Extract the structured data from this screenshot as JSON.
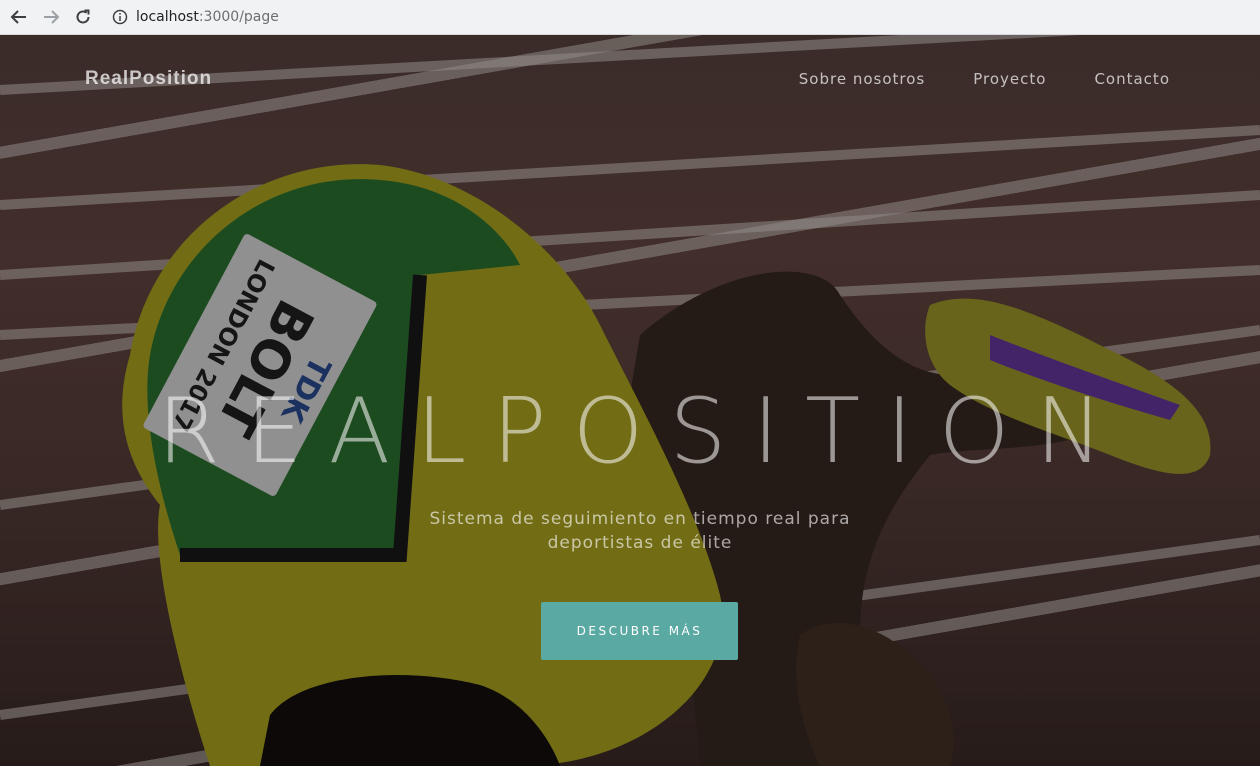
{
  "browser": {
    "url_host": "localhost",
    "url_path": ":3000/page"
  },
  "navbar": {
    "brand": "RealPosition",
    "links": [
      "Sobre nosotros",
      "Proyecto",
      "Contacto"
    ]
  },
  "hero": {
    "title": "REALPOSITION",
    "subtitle": "Sistema de seguimiento en tiempo real para deportistas de élite",
    "cta_label": "DESCUBRE MÁS",
    "bib_text": [
      "LONDON 2017",
      "BOLT",
      "TDK"
    ]
  },
  "colors": {
    "accent": "#5aa9a3",
    "track": "#6b4b45",
    "jersey": "#c8b81f"
  },
  "icons": [
    "back-arrow-icon",
    "forward-arrow-icon",
    "reload-icon",
    "info-icon"
  ]
}
